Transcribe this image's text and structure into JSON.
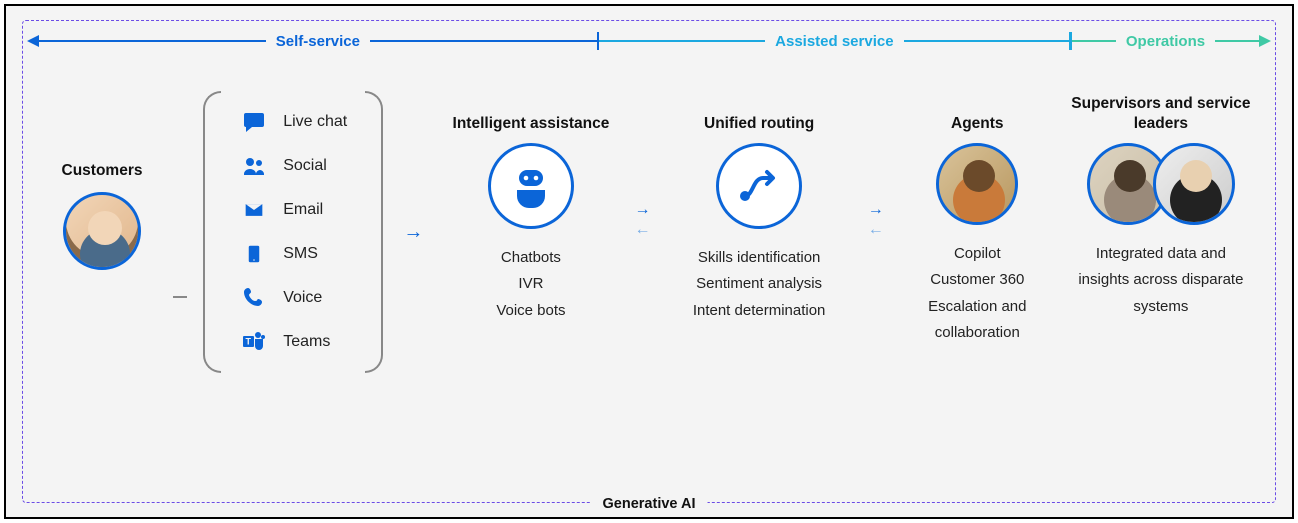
{
  "timeline": {
    "self_service": "Self-service",
    "assisted_service": "Assisted service",
    "operations": "Operations"
  },
  "customers": {
    "title": "Customers"
  },
  "channels": {
    "items": [
      {
        "icon": "chat",
        "label": "Live chat"
      },
      {
        "icon": "social",
        "label": "Social"
      },
      {
        "icon": "email",
        "label": "Email"
      },
      {
        "icon": "sms",
        "label": "SMS"
      },
      {
        "icon": "voice",
        "label": "Voice"
      },
      {
        "icon": "teams",
        "label": "Teams"
      }
    ]
  },
  "intelligent": {
    "title": "Intelligent assistance",
    "items": [
      "Chatbots",
      "IVR",
      "Voice bots"
    ]
  },
  "routing": {
    "title": "Unified routing",
    "items": [
      "Skills identification",
      "Sentiment analysis",
      "Intent determination"
    ]
  },
  "agents": {
    "title": "Agents",
    "items": [
      "Copilot",
      "Customer 360",
      "Escalation and collaboration"
    ]
  },
  "supervisors": {
    "title": "Supervisors and service leaders",
    "items": [
      "Integrated data and insights across disparate systems"
    ]
  },
  "footer": "Generative AI"
}
